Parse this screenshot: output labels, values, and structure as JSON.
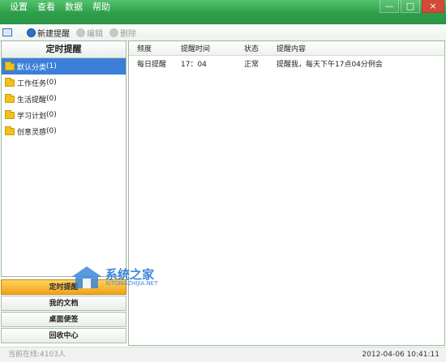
{
  "menu": [
    "设置",
    "查看",
    "数据",
    "帮助"
  ],
  "window_controls": {
    "minimize": "—",
    "maximize": "□",
    "close": "×"
  },
  "toolbar": {
    "new": "新建提醒",
    "edit": "编辑",
    "delete": "删除"
  },
  "left_panel": {
    "title": "定时提醒",
    "items": [
      {
        "label": "默认分类",
        "count": "(1)",
        "selected": true
      },
      {
        "label": "工作任务",
        "count": "(0)"
      },
      {
        "label": "生活提醒",
        "count": "(0)"
      },
      {
        "label": "学习计划",
        "count": "(0)"
      },
      {
        "label": "创意灵感",
        "count": "(0)"
      }
    ]
  },
  "nav": [
    {
      "label": "定时提醒",
      "active": true
    },
    {
      "label": "我的文档"
    },
    {
      "label": "桌面便签"
    },
    {
      "label": "回收中心"
    }
  ],
  "table": {
    "headers": [
      "频度",
      "提醒时间",
      "状态",
      "提醒内容"
    ],
    "rows": [
      [
        "每日提醒",
        "17：04",
        "正常",
        "提醒我，每天下午17点04分例会"
      ]
    ]
  },
  "status": {
    "online": "当前在线:4103人",
    "datetime": "2012-04-06 10:41:11"
  },
  "watermark": {
    "text": "系统之家",
    "sub": "XITONGZHIJIA.NET"
  },
  "colors": {
    "title_green": "#2e9e4a",
    "selected_blue": "#3c7fd8",
    "active_orange": "#f0a21a"
  }
}
